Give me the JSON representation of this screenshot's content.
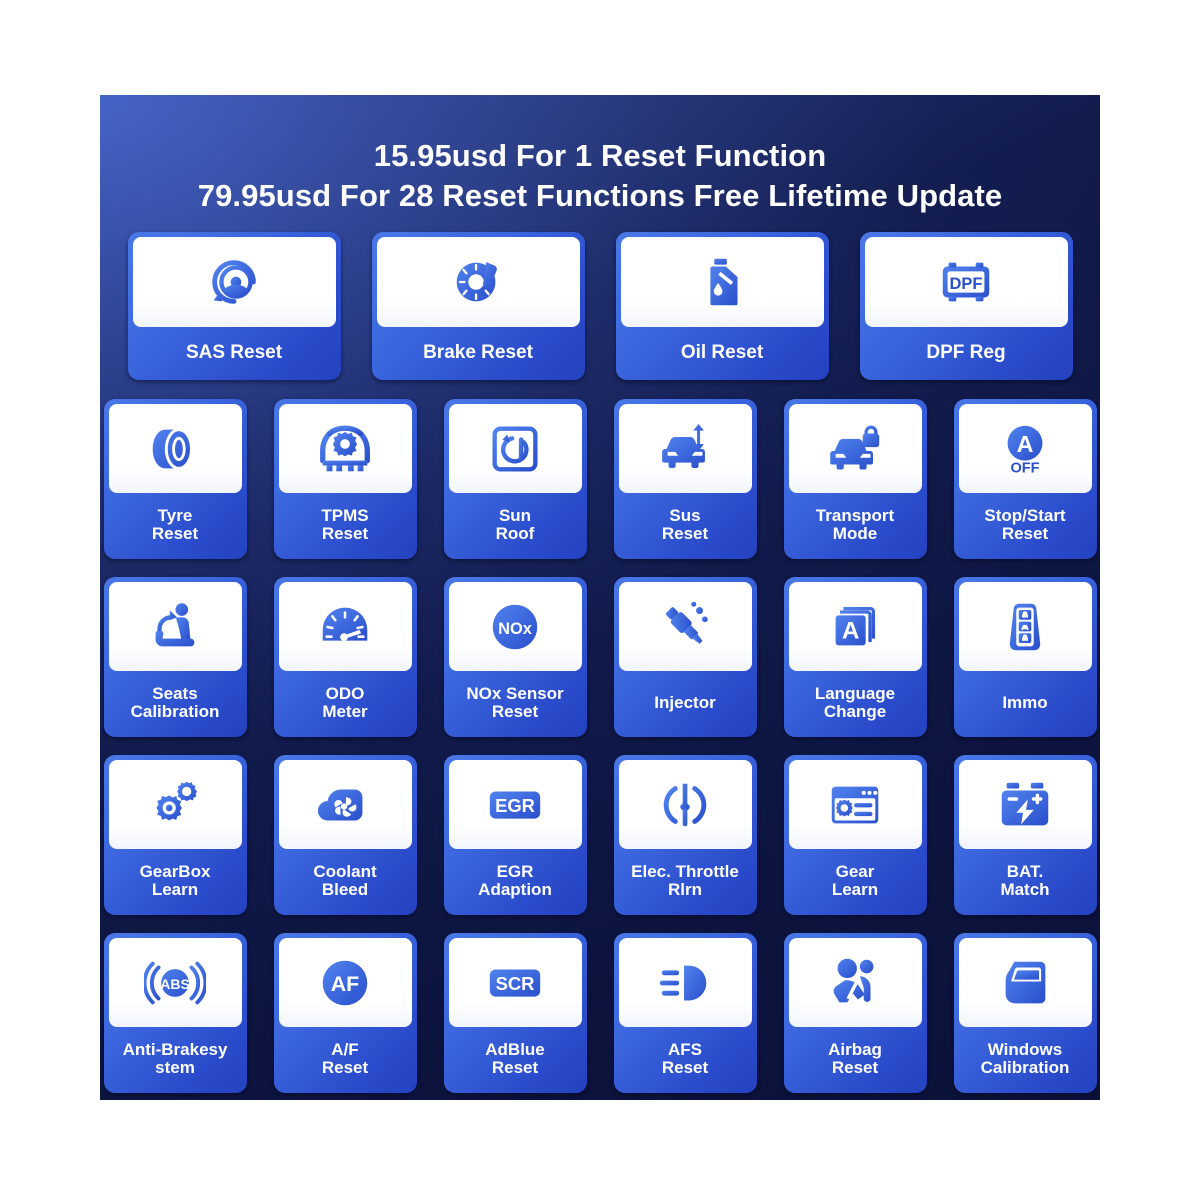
{
  "headline": {
    "line1": "15.95usd For 1 Reset Function",
    "line2": "79.95usd  For 28 Reset Functions Free Lifetime Update"
  },
  "theme": {
    "panel_top_left": "#3c5bbf",
    "panel_bottom_right": "#0e1642",
    "tile_blue_light": "#4a78e8",
    "tile_blue_dark": "#2442c0",
    "icon_blue_light": "#5183ee",
    "icon_blue_dark": "#2a4fcc",
    "label_text": "#ffffff",
    "icon_panel": "#ffffff"
  },
  "rows": [
    {
      "id": "row-1",
      "tiles": [
        {
          "icon": "steering-wheel-reset-icon",
          "line1": "SAS Reset",
          "line2": ""
        },
        {
          "icon": "brake-disc-icon",
          "line1": "Brake Reset",
          "line2": ""
        },
        {
          "icon": "oil-bottle-icon",
          "line1": "Oil Reset",
          "line2": ""
        },
        {
          "icon": "dpf-module-icon",
          "line1": "DPF Reg",
          "line2": ""
        }
      ]
    },
    {
      "id": "row-2",
      "tiles": [
        {
          "icon": "tyre-icon",
          "line1": "Tyre",
          "line2": "Reset"
        },
        {
          "icon": "tpms-tyre-gear-icon",
          "line1": "TPMS",
          "line2": "Reset"
        },
        {
          "icon": "sunroof-icon",
          "line1": "Sun",
          "line2": "Roof"
        },
        {
          "icon": "car-suspension-icon",
          "line1": "Sus",
          "line2": "Reset"
        },
        {
          "icon": "car-lock-icon",
          "line1": "Transport",
          "line2": "Mode"
        },
        {
          "icon": "auto-stop-start-icon",
          "line1": "Stop/Start",
          "line2": "Reset"
        }
      ]
    },
    {
      "id": "row-3",
      "tiles": [
        {
          "icon": "car-seat-icon",
          "line1": "Seats",
          "line2": "Calibration"
        },
        {
          "icon": "odometer-gauge-icon",
          "line1": "ODO",
          "line2": "Meter"
        },
        {
          "icon": "nox-sensor-icon",
          "line1": "NOx Sensor",
          "line2": "Reset"
        },
        {
          "icon": "fuel-injector-icon",
          "line1": "Injector",
          "line2": ""
        },
        {
          "icon": "language-book-icon",
          "line1": "Language",
          "line2": "Change"
        },
        {
          "icon": "car-key-fob-icon",
          "line1": "Immo",
          "line2": ""
        }
      ]
    },
    {
      "id": "row-4",
      "tiles": [
        {
          "icon": "gearbox-gears-icon",
          "line1": "GearBox",
          "line2": "Learn"
        },
        {
          "icon": "coolant-fan-icon",
          "line1": "Coolant",
          "line2": "Bleed"
        },
        {
          "icon": "egr-badge-icon",
          "line1": "EGR",
          "line2": "Adaption"
        },
        {
          "icon": "throttle-body-icon",
          "line1": "Elec. Throttle",
          "line2": "Rlrn"
        },
        {
          "icon": "gear-learn-screen-icon",
          "line1": "Gear",
          "line2": "Learn"
        },
        {
          "icon": "battery-icon",
          "line1": "BAT.",
          "line2": "Match"
        }
      ]
    },
    {
      "id": "row-5",
      "tiles": [
        {
          "icon": "abs-brake-icon",
          "line1": "Anti-Brakesy",
          "line2": "stem"
        },
        {
          "icon": "af-badge-icon",
          "line1": "A/F",
          "line2": "Reset"
        },
        {
          "icon": "scr-badge-icon",
          "line1": "AdBlue",
          "line2": "Reset"
        },
        {
          "icon": "headlight-afs-icon",
          "line1": "AFS",
          "line2": "Reset"
        },
        {
          "icon": "airbag-seatbelt-icon",
          "line1": "Airbag",
          "line2": "Reset"
        },
        {
          "icon": "car-door-window-icon",
          "line1": "Windows",
          "line2": "Calibration"
        }
      ]
    }
  ],
  "icon_text": {
    "dpf": "DPF",
    "stop_start_a": "A",
    "stop_start_off": "OFF",
    "nox": "NOx",
    "language_a": "A",
    "egr": "EGR",
    "abs": "ABS",
    "af": "AF",
    "scr": "SCR"
  }
}
